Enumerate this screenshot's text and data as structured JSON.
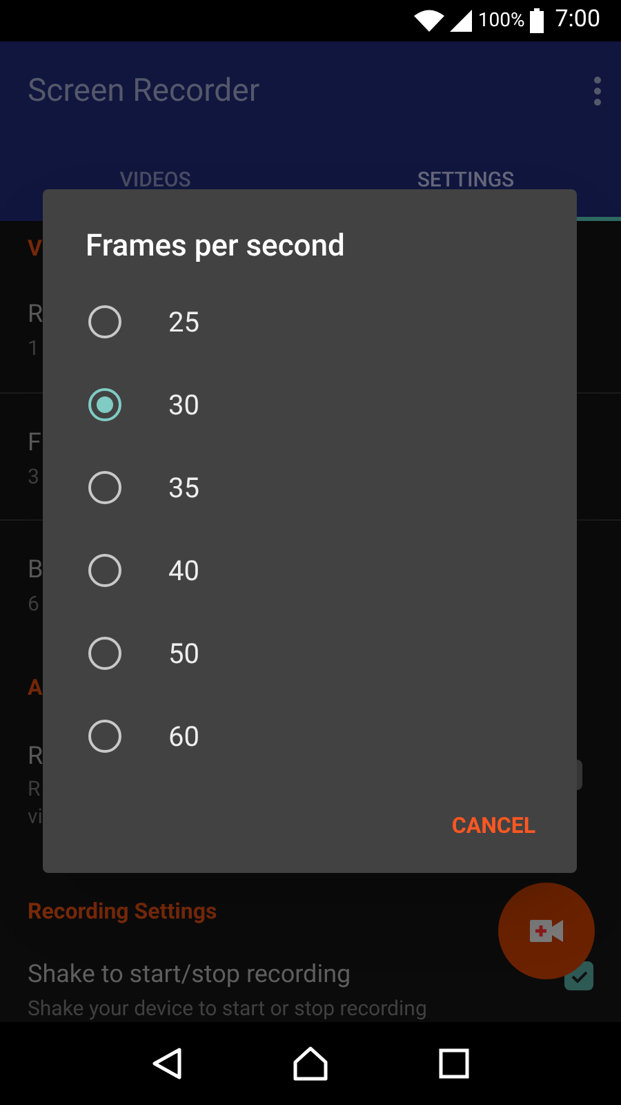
{
  "status_bar": {
    "battery": "100%",
    "time": "7:00"
  },
  "app_bar": {
    "title": "Screen Recorder"
  },
  "tabs": [
    {
      "label": "VIDEOS",
      "selected": false
    },
    {
      "label": "SETTINGS",
      "selected": true
    }
  ],
  "background": [
    {
      "kind": "header",
      "text": "V"
    },
    {
      "kind": "row",
      "title": "R",
      "subtitle": "1"
    },
    {
      "kind": "row",
      "title": "F",
      "subtitle": "3"
    },
    {
      "kind": "row",
      "title": "B",
      "subtitle": "6"
    },
    {
      "kind": "header",
      "text": "A"
    },
    {
      "kind": "toggle_row",
      "title": "R",
      "subtitle": "R",
      "subtitle_2": "vi"
    },
    {
      "kind": "header",
      "text": "Recording Settings"
    },
    {
      "kind": "check_row",
      "title": "Shake to start/stop recording",
      "subtitle": "Shake your device to start or stop recording",
      "checked": true
    }
  ],
  "dialog": {
    "title": "Frames per second",
    "options": [
      {
        "label": "25",
        "selected": false
      },
      {
        "label": "30",
        "selected": true
      },
      {
        "label": "35",
        "selected": false
      },
      {
        "label": "40",
        "selected": false
      },
      {
        "label": "50",
        "selected": false
      },
      {
        "label": "60",
        "selected": false
      }
    ],
    "button": "CANCEL"
  }
}
